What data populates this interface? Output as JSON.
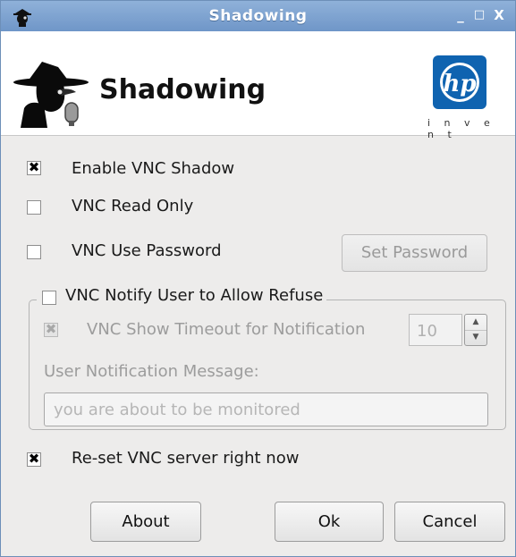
{
  "window": {
    "title": "Shadowing",
    "controls": {
      "minimize": "_",
      "maximize": "□",
      "close": "X"
    }
  },
  "header": {
    "title": "Shadowing",
    "icon": "spy-shadow-icon",
    "brand": {
      "logo_text": "hp",
      "tagline": "i n v e n t"
    }
  },
  "options": {
    "enable_vnc_shadow": {
      "label": "Enable VNC Shadow",
      "checked": true
    },
    "vnc_read_only": {
      "label": "VNC Read Only",
      "checked": false
    },
    "vnc_use_password": {
      "label": "VNC Use Password",
      "checked": false
    },
    "set_password_label": "Set Password"
  },
  "notify_group": {
    "legend": "VNC Notify User to Allow Refuse",
    "checked": false,
    "show_timeout": {
      "label": "VNC Show Timeout for Notification",
      "checked": true,
      "enabled": false
    },
    "timeout_value": "10",
    "message_label": "User Notification Message:",
    "message_value": "you are about to be monitored"
  },
  "reset": {
    "label": "Re-set VNC server right now",
    "checked": true
  },
  "buttons": {
    "about": "About",
    "ok": "Ok",
    "cancel": "Cancel"
  },
  "colors": {
    "titlebar": "#7ea3d1",
    "background": "#edeceb",
    "hp_blue": "#0f63b0"
  }
}
